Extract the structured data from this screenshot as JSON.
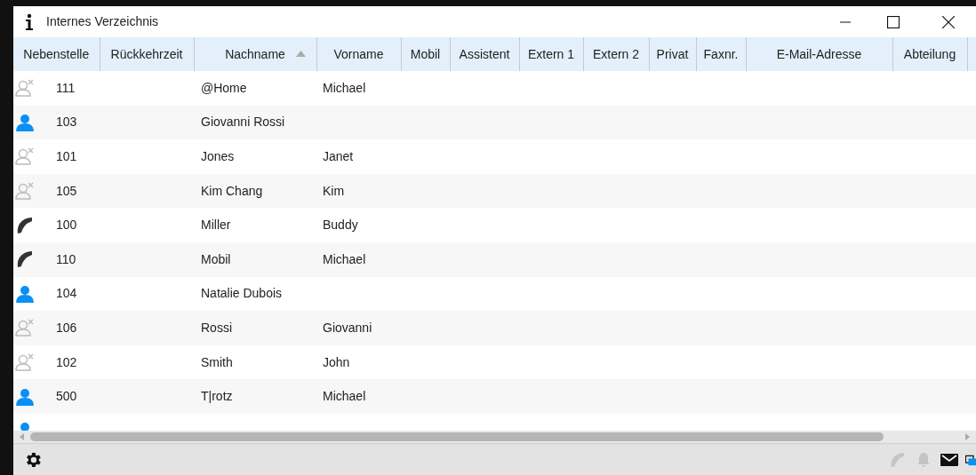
{
  "window": {
    "title": "Internes Verzeichnis"
  },
  "table": {
    "columns": [
      {
        "label": "Nebenstelle",
        "sorted": false
      },
      {
        "label": "Rückkehrzeit",
        "sorted": false
      },
      {
        "label": "Nachname",
        "sorted": true
      },
      {
        "label": "Vorname",
        "sorted": false
      },
      {
        "label": "Mobil",
        "sorted": false
      },
      {
        "label": "Assistent",
        "sorted": false
      },
      {
        "label": "Extern 1",
        "sorted": false
      },
      {
        "label": "Extern 2",
        "sorted": false
      },
      {
        "label": "Privat",
        "sorted": false
      },
      {
        "label": "Faxnr.",
        "sorted": false
      },
      {
        "label": "E-Mail-Adresse",
        "sorted": false
      },
      {
        "label": "Abteilung",
        "sorted": false
      }
    ],
    "rows": [
      {
        "kind": "offline",
        "extension": "111",
        "last_name": "@Home",
        "first_name": "Michael"
      },
      {
        "kind": "available",
        "extension": "103",
        "last_name": "Giovanni Rossi"
      },
      {
        "kind": "offline",
        "extension": "101",
        "last_name": "Jones",
        "first_name": "Janet"
      },
      {
        "kind": "offline",
        "extension": "105",
        "last_name": "Kim Chang",
        "first_name": "Kim"
      },
      {
        "kind": "on_phone",
        "extension": "100",
        "last_name": "Miller",
        "first_name": "Buddy"
      },
      {
        "kind": "on_phone",
        "extension": "110",
        "last_name": "Mobil",
        "first_name": "Michael"
      },
      {
        "kind": "available",
        "extension": "104",
        "last_name": "Natalie Dubois"
      },
      {
        "kind": "offline",
        "extension": "106",
        "last_name": "Rossi",
        "first_name": "Giovanni"
      },
      {
        "kind": "offline",
        "extension": "102",
        "last_name": "Smith",
        "first_name": "John"
      },
      {
        "kind": "available",
        "extension": "500",
        "last_name": "T|rotz",
        "first_name": "Michael"
      },
      {
        "kind": "available"
      }
    ]
  }
}
